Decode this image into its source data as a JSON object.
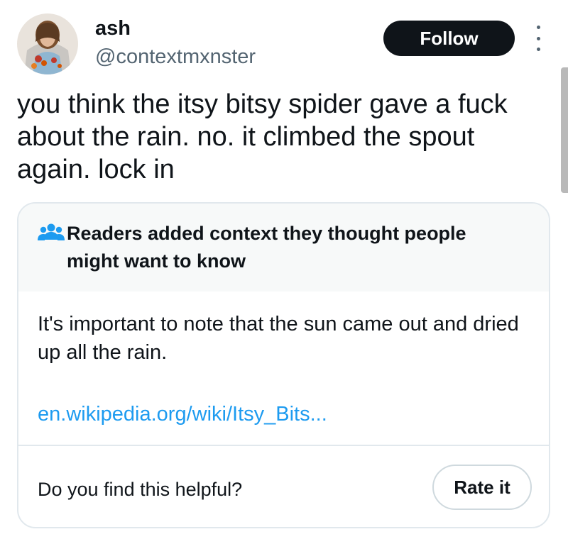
{
  "author": {
    "display_name": "ash",
    "handle": "@contextmxnster",
    "avatar_icon": "profile-avatar"
  },
  "actions": {
    "follow_label": "Follow",
    "more_icon": "more-vertical-icon"
  },
  "tweet": {
    "text": "you think the itsy bitsy spider gave a fuck about the rain. no. it climbed the spout again. lock in"
  },
  "community_note": {
    "icon": "people-icon",
    "title": "Readers added context they thought people might want to know",
    "body": "It's important to note that the sun came out and dried up all the rain.",
    "link_text": "en.wikipedia.org/wiki/Itsy_Bits...",
    "helpful_question": "Do you find this helpful?",
    "rate_label": "Rate it"
  },
  "colors": {
    "link": "#1d9bf0",
    "icon_blue": "#1d9bf0",
    "secondary_text": "#536471",
    "follow_bg": "#0f1419",
    "header_bg": "#f7f9f9"
  }
}
